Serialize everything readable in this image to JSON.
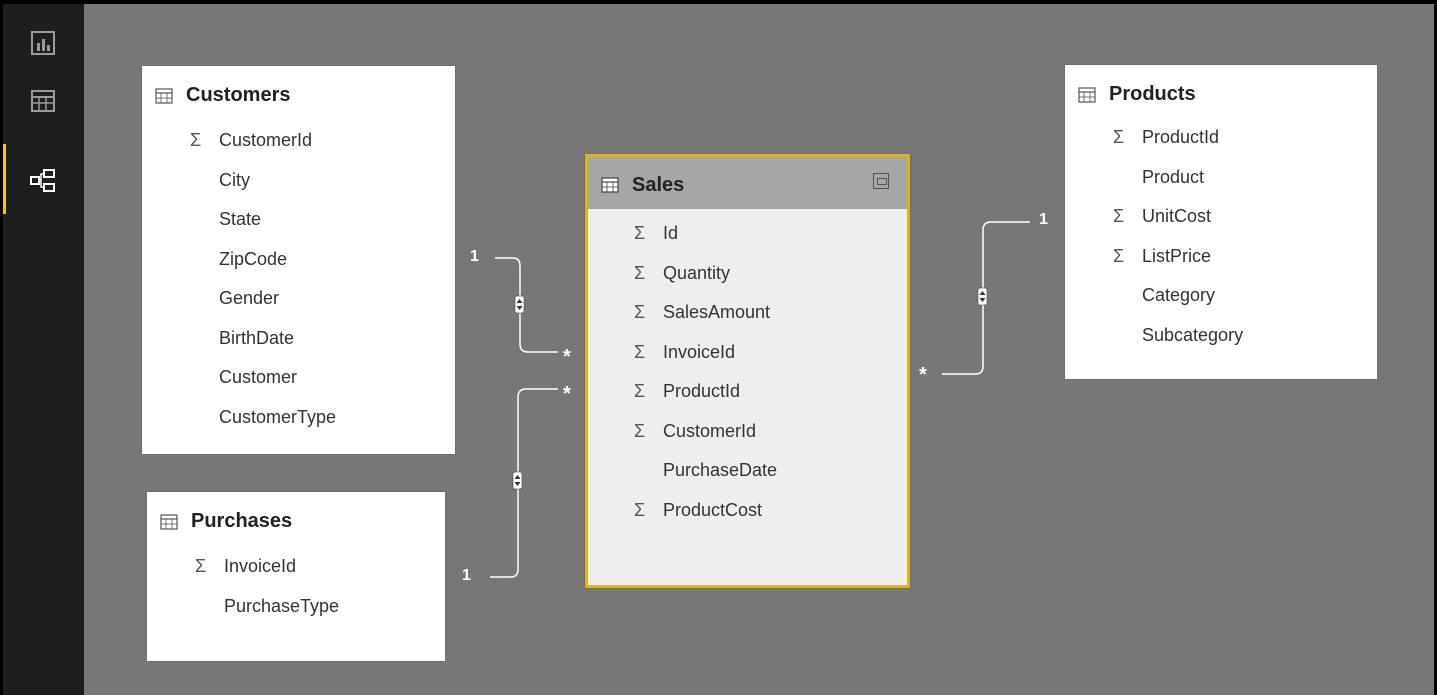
{
  "sidebar": {
    "items": [
      {
        "icon": "report-view-icon",
        "active": false
      },
      {
        "icon": "data-view-icon",
        "active": false
      },
      {
        "icon": "relationships-view-icon",
        "active": true
      }
    ],
    "accent_color": "#f2c811"
  },
  "tables": {
    "customers": {
      "title": "Customers",
      "fields": [
        {
          "name": "CustomerId",
          "sigma": true
        },
        {
          "name": "City",
          "sigma": false
        },
        {
          "name": "State",
          "sigma": false
        },
        {
          "name": "ZipCode",
          "sigma": false
        },
        {
          "name": "Gender",
          "sigma": false
        },
        {
          "name": "BirthDate",
          "sigma": false
        },
        {
          "name": "Customer",
          "sigma": false
        },
        {
          "name": "CustomerType",
          "sigma": false
        }
      ]
    },
    "purchases": {
      "title": "Purchases",
      "fields": [
        {
          "name": "InvoiceId",
          "sigma": true
        },
        {
          "name": "PurchaseType",
          "sigma": false
        }
      ]
    },
    "sales": {
      "title": "Sales",
      "fields": [
        {
          "name": "Id",
          "sigma": true
        },
        {
          "name": "Quantity",
          "sigma": true
        },
        {
          "name": "SalesAmount",
          "sigma": true
        },
        {
          "name": "InvoiceId",
          "sigma": true
        },
        {
          "name": "ProductId",
          "sigma": true
        },
        {
          "name": "CustomerId",
          "sigma": true
        },
        {
          "name": "PurchaseDate",
          "sigma": false
        },
        {
          "name": "ProductCost",
          "sigma": true
        }
      ]
    },
    "products": {
      "title": "Products",
      "fields": [
        {
          "name": "ProductId",
          "sigma": true
        },
        {
          "name": "Product",
          "sigma": false
        },
        {
          "name": "UnitCost",
          "sigma": true
        },
        {
          "name": "ListPrice",
          "sigma": true
        },
        {
          "name": "Category",
          "sigma": false
        },
        {
          "name": "Subcategory",
          "sigma": false
        }
      ]
    }
  },
  "relationships": {
    "customers_sales": {
      "one": "1",
      "many": "*"
    },
    "purchases_sales": {
      "one": "1",
      "many": "*"
    },
    "products_sales": {
      "one": "1",
      "many": "*"
    }
  },
  "sigma_symbol": "Σ",
  "colors": {
    "canvas": "#777777",
    "sidebar": "#1e1e1e",
    "selected_border": "#e0b31a"
  }
}
